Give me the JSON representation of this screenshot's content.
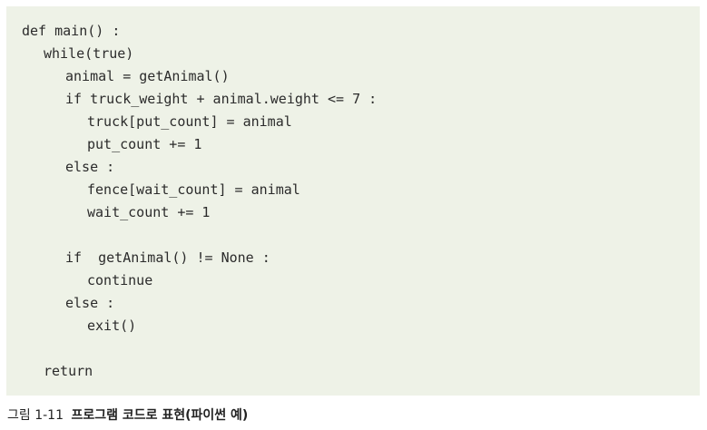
{
  "code": {
    "lines": [
      {
        "text": "def main() :",
        "indent": 0
      },
      {
        "text": "while(true)",
        "indent": 1
      },
      {
        "text": "animal = getAnimal()",
        "indent": 2
      },
      {
        "text": "if truck_weight + animal.weight <= 7 :",
        "indent": 2
      },
      {
        "text": "truck[put_count] = animal",
        "indent": 3
      },
      {
        "text": "put_count += 1",
        "indent": 3
      },
      {
        "text": "else :",
        "indent": 2
      },
      {
        "text": "fence[wait_count] = animal",
        "indent": 3
      },
      {
        "text": "wait_count += 1",
        "indent": 3
      },
      {
        "text": "",
        "indent": 0
      },
      {
        "text": "if  getAnimal() != None :",
        "indent": 2
      },
      {
        "text": "continue",
        "indent": 3
      },
      {
        "text": "else :",
        "indent": 2
      },
      {
        "text": "exit()",
        "indent": 3
      },
      {
        "text": "",
        "indent": 0
      },
      {
        "text": "return",
        "indent": 1
      }
    ]
  },
  "caption": {
    "label": "그림 1-11",
    "title": "프로그램 코드로 표현(파이썬 예)"
  }
}
